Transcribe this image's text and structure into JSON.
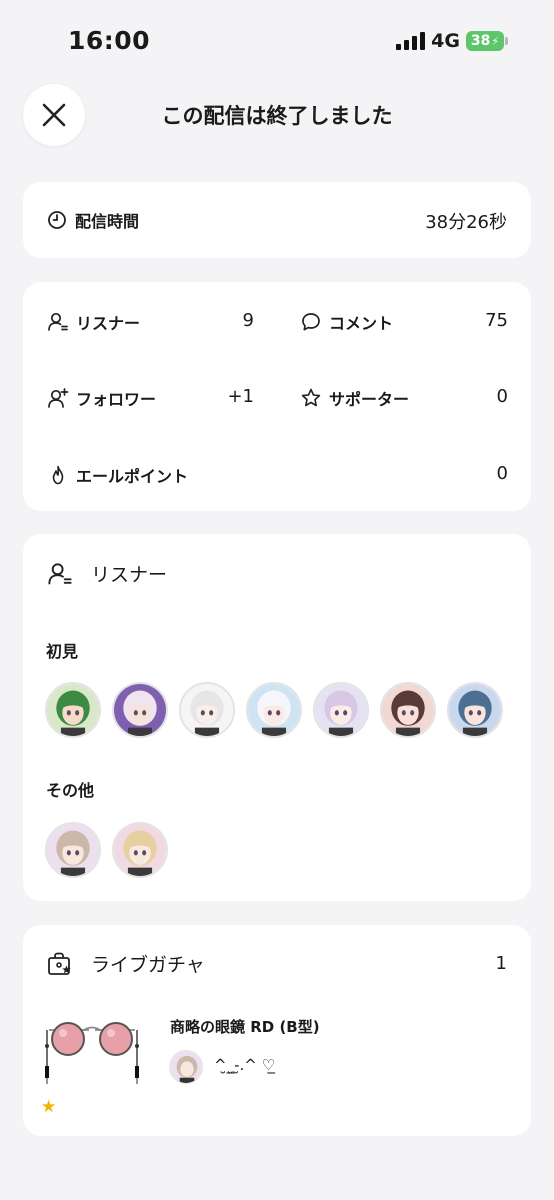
{
  "status_bar": {
    "time": "16:00",
    "network": "4G",
    "battery": "38"
  },
  "header": {
    "title": "この配信は終了しました"
  },
  "broadcast_time": {
    "label": "配信時間",
    "value": "38分26秒"
  },
  "stats": {
    "listeners": {
      "label": "リスナー",
      "value": "9"
    },
    "comments": {
      "label": "コメント",
      "value": "75"
    },
    "followers": {
      "label": "フォロワー",
      "value": "+1"
    },
    "supporters": {
      "label": "サポーター",
      "value": "0"
    },
    "cheer_points": {
      "label": "エールポイント",
      "value": "0"
    }
  },
  "listeners_section": {
    "title": "リスナー",
    "first_time_label": "初見",
    "first_time_avatars": [
      {
        "bg": "#d9e8c8",
        "hair": "#3c8a44",
        "skin": "#f6dcc8"
      },
      {
        "bg": "#7f5fb0",
        "hair": "#f0e4ef",
        "skin": "#f8e3dc"
      },
      {
        "bg": "#f5f5f5",
        "hair": "#e6e6e8",
        "skin": "#fbeee8"
      },
      {
        "bg": "#cfe4f2",
        "hair": "#f4f6fb",
        "skin": "#fbe9e6"
      },
      {
        "bg": "#e5e2f4",
        "hair": "#d8c8e6",
        "skin": "#fbece6"
      },
      {
        "bg": "#f2d8d2",
        "hair": "#5b3a3a",
        "skin": "#fae0d6"
      },
      {
        "bg": "#c9d8ee",
        "hair": "#4e6f94",
        "skin": "#f8e4da"
      }
    ],
    "other_label": "その他",
    "other_avatars": [
      {
        "bg": "#ecdff0",
        "hair": "#cbb8a8",
        "skin": "#f9e6dc"
      },
      {
        "bg": "#f1d9e2",
        "hair": "#e6d0a0",
        "skin": "#f9e8dc"
      }
    ]
  },
  "gacha": {
    "title": "ライブガチャ",
    "count": "1",
    "item_name": "商略の眼鏡 RD (B型)",
    "giver_name": "^̮_̮-̮.^ ♡̲",
    "item_rarity_icon": "star-icon"
  },
  "colors": {
    "background": "#f4f4f6",
    "card": "#ffffff",
    "battery": "#5ec56a",
    "lens": "#e8a0a8"
  }
}
